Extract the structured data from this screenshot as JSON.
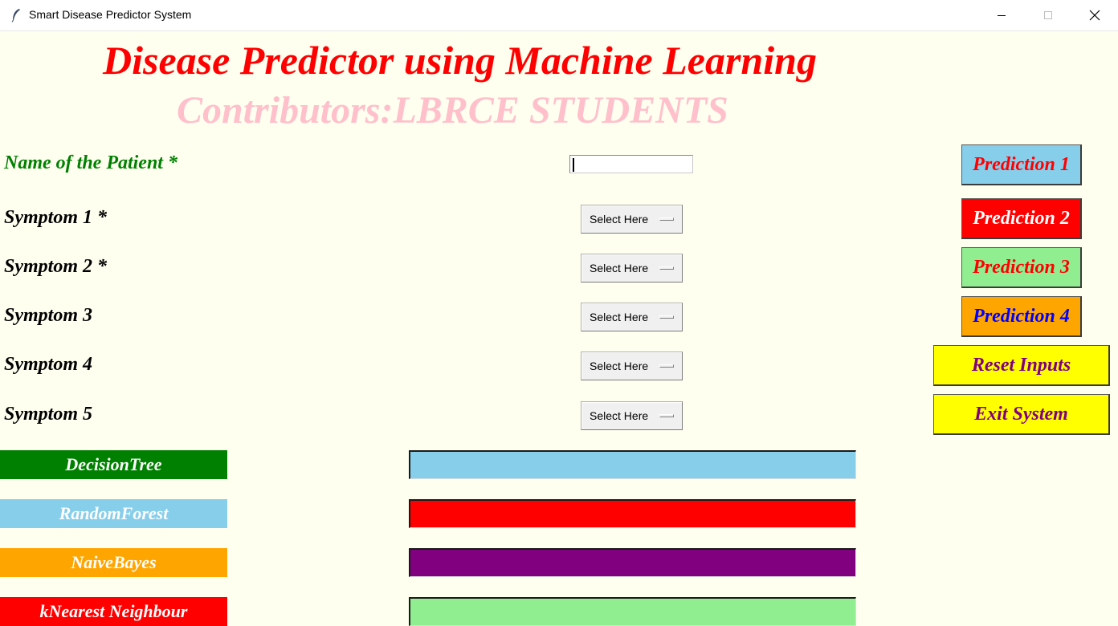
{
  "window": {
    "title": "Smart Disease Predictor System",
    "icon": "feather-icon"
  },
  "header": {
    "title": "Disease Predictor using Machine Learning",
    "contributors": "Contributors:LBRCE STUDENTS"
  },
  "form": {
    "name_label": "Name of the Patient *",
    "name_value": "",
    "symptoms": [
      {
        "label": "Symptom 1 *",
        "selected": "Select Here"
      },
      {
        "label": "Symptom 2 *",
        "selected": "Select Here"
      },
      {
        "label": "Symptom 3",
        "selected": "Select Here"
      },
      {
        "label": "Symptom 4",
        "selected": "Select Here"
      },
      {
        "label": "Symptom 5",
        "selected": "Select Here"
      }
    ]
  },
  "buttons": [
    {
      "label": "Prediction 1",
      "bg": "#87ceeb",
      "fg": "#ff0000"
    },
    {
      "label": "Prediction 2",
      "bg": "#ff0000",
      "fg": "#ffffff"
    },
    {
      "label": "Prediction 3",
      "bg": "#90ee90",
      "fg": "#ff0000"
    },
    {
      "label": "Prediction 4",
      "bg": "#ffa500",
      "fg": "#0000ff"
    },
    {
      "label": "Reset Inputs",
      "bg": "#ffff00",
      "fg": "#800080"
    },
    {
      "label": "Exit System",
      "bg": "#ffff00",
      "fg": "#800080"
    }
  ],
  "algorithms": [
    {
      "label": "DecisionTree",
      "bg": "#008000",
      "result": "",
      "result_bg": "#87ceeb"
    },
    {
      "label": "RandomForest",
      "bg": "#87ceeb",
      "result": "",
      "result_bg": "#ff0000"
    },
    {
      "label": "NaiveBayes",
      "bg": "#ffa500",
      "result": "",
      "result_bg": "#800080"
    },
    {
      "label": "kNearest Neighbour",
      "bg": "#ff0000",
      "result": "",
      "result_bg": "#90ee90"
    }
  ]
}
